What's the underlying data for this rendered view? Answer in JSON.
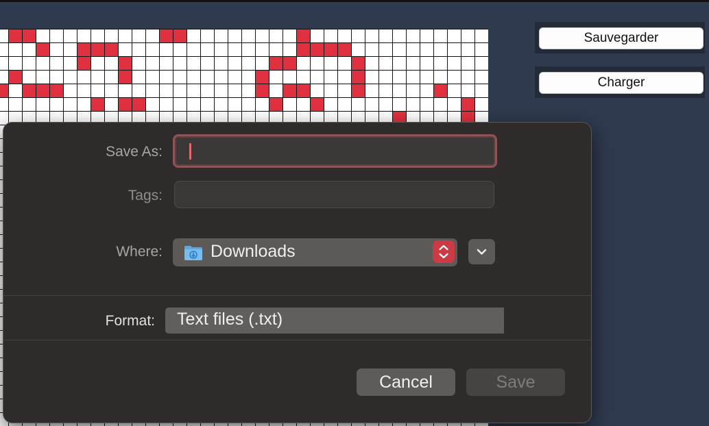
{
  "side_buttons": {
    "save_label": "Sauvegarder",
    "load_label": "Charger"
  },
  "grid": {
    "columns": 36,
    "rows": 30,
    "on_color": "#e1303f",
    "off_color": "#ffffff",
    "visible_on_cells": [
      [
        0,
        1
      ],
      [
        0,
        2
      ],
      [
        0,
        12
      ],
      [
        0,
        13
      ],
      [
        0,
        22
      ],
      [
        1,
        3
      ],
      [
        1,
        6
      ],
      [
        1,
        7
      ],
      [
        1,
        8
      ],
      [
        1,
        22
      ],
      [
        1,
        23
      ],
      [
        1,
        24
      ],
      [
        1,
        25
      ],
      [
        2,
        6
      ],
      [
        2,
        9
      ],
      [
        2,
        20
      ],
      [
        2,
        21
      ],
      [
        2,
        26
      ],
      [
        3,
        1
      ],
      [
        3,
        9
      ],
      [
        3,
        19
      ],
      [
        3,
        26
      ],
      [
        4,
        0
      ],
      [
        4,
        2
      ],
      [
        4,
        3
      ],
      [
        4,
        4
      ],
      [
        4,
        19
      ],
      [
        4,
        21
      ],
      [
        4,
        22
      ],
      [
        4,
        26
      ],
      [
        4,
        32
      ],
      [
        5,
        7
      ],
      [
        5,
        9
      ],
      [
        5,
        10
      ],
      [
        5,
        20
      ],
      [
        5,
        23
      ],
      [
        5,
        34
      ],
      [
        6,
        29
      ],
      [
        6,
        34
      ]
    ]
  },
  "dialog": {
    "save_as_label": "Save As:",
    "save_as_value": "",
    "tags_label": "Tags:",
    "tags_value": "",
    "where_label": "Where:",
    "where_value": "Downloads",
    "format_label": "Format:",
    "format_value": "Text files (.txt)",
    "cancel_label": "Cancel",
    "save_label": "Save"
  },
  "icons": {
    "where_folder": "downloads-folder-icon",
    "where_stepper": "up-down-chevron-icon",
    "expand": "chevron-down-icon"
  },
  "colors": {
    "accent": "#cc3b44",
    "focus_ring": "#8d5456",
    "folder": "#5aa9e6"
  }
}
